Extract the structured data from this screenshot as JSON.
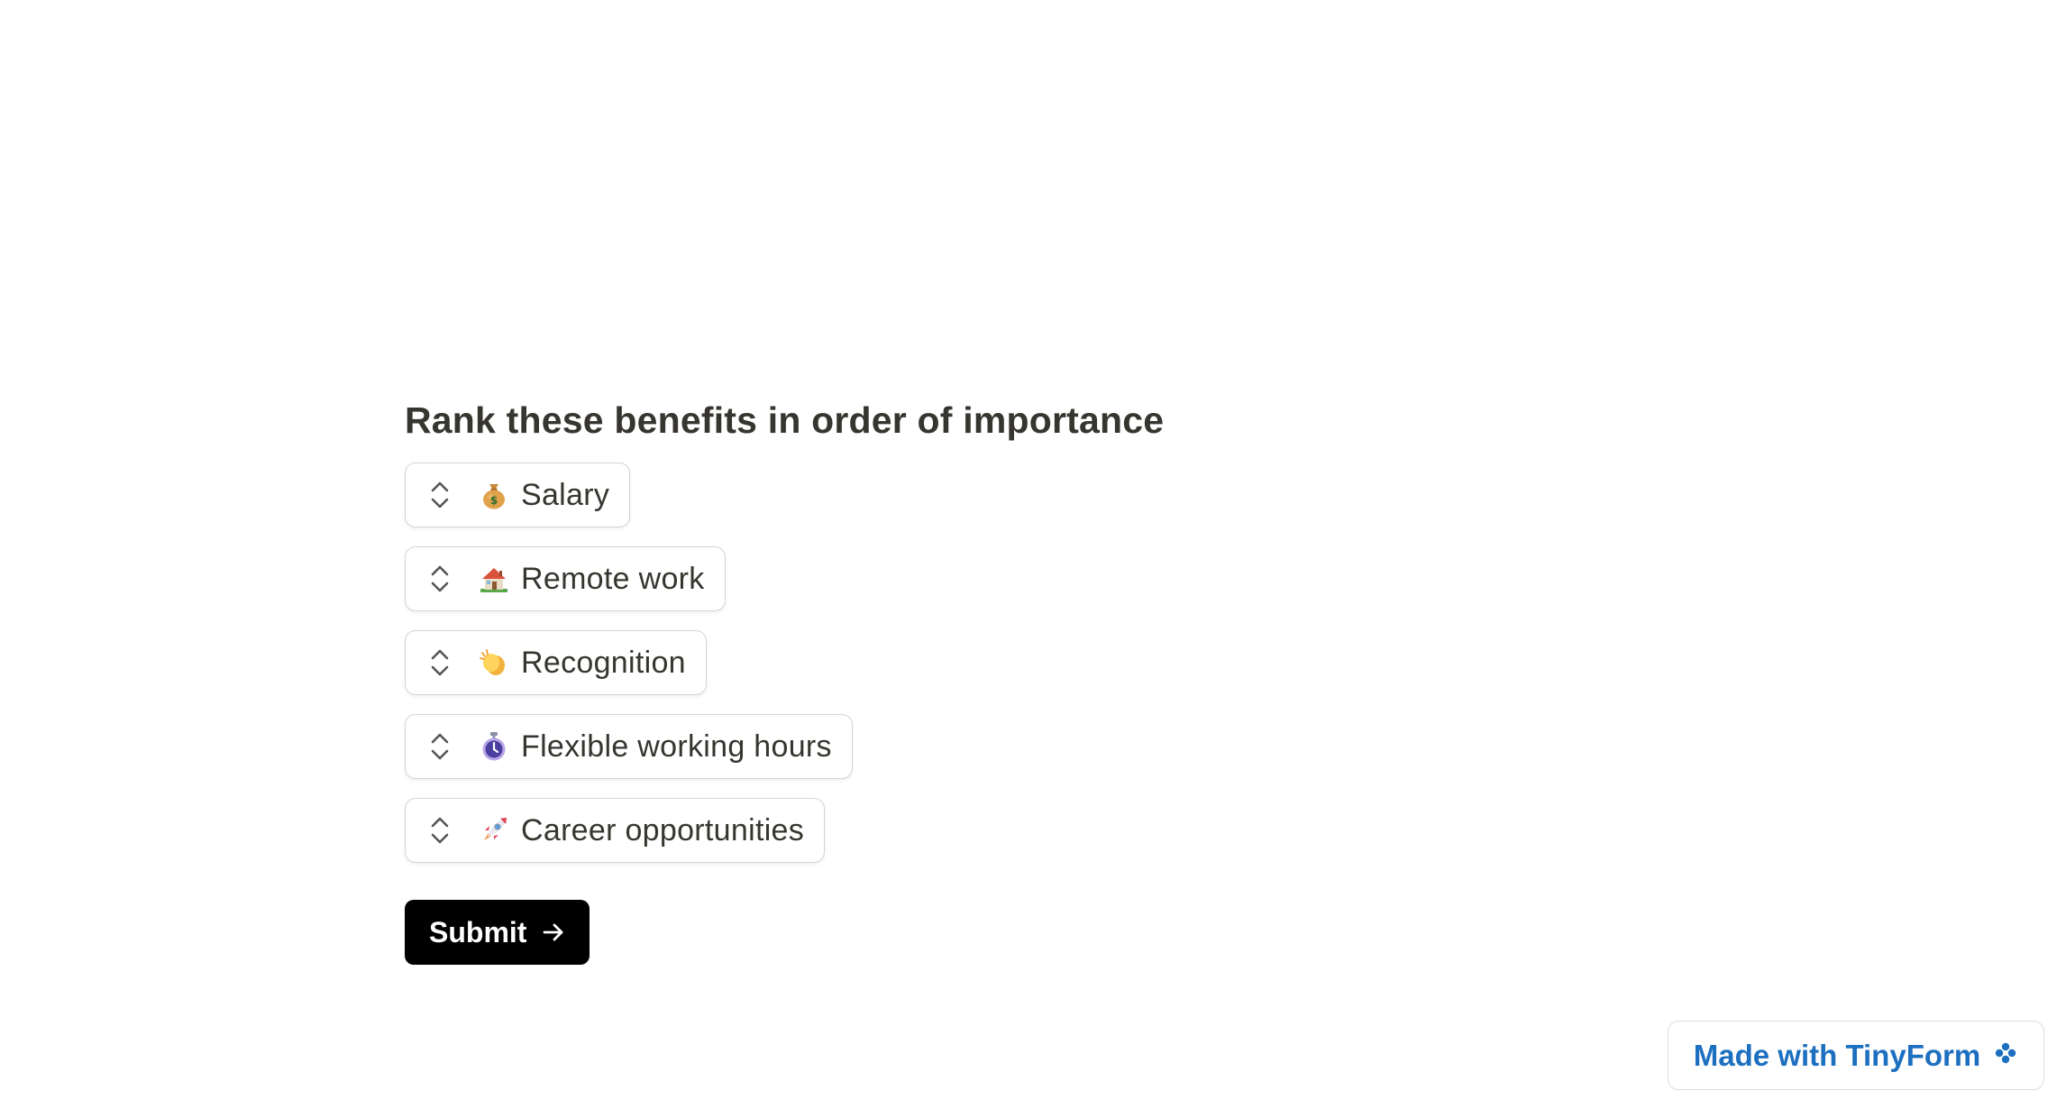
{
  "form": {
    "question": "Rank these benefits in order of importance",
    "items": [
      {
        "label": "Salary",
        "icon": "money-bag-icon"
      },
      {
        "label": "Remote work",
        "icon": "house-icon"
      },
      {
        "label": "Recognition",
        "icon": "clapping-hands-icon"
      },
      {
        "label": "Flexible working hours",
        "icon": "stopwatch-icon"
      },
      {
        "label": "Career opportunities",
        "icon": "rocket-icon"
      }
    ],
    "submit_label": "Submit"
  },
  "badge": {
    "label": "Made with TinyForm",
    "icon": "tinyform-logo-icon",
    "color": "#1d6fc0"
  }
}
